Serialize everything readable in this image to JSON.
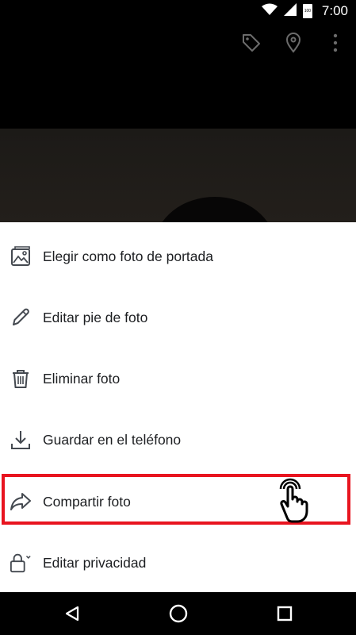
{
  "status_bar": {
    "time": "7:00",
    "battery_level": "100",
    "icons": [
      "wifi-icon",
      "signal-icon",
      "battery-icon"
    ]
  },
  "top_actions": {
    "icons": [
      "tag-icon",
      "location-pin-icon",
      "more-vertical-icon"
    ]
  },
  "menu": {
    "items": [
      {
        "label": "Elegir como foto de portada",
        "icon": "cover-photo-icon"
      },
      {
        "label": "Editar pie de foto",
        "icon": "pencil-icon"
      },
      {
        "label": "Eliminar foto",
        "icon": "trash-icon"
      },
      {
        "label": "Guardar en el teléfono",
        "icon": "download-icon"
      },
      {
        "label": "Compartir foto",
        "icon": "share-icon"
      },
      {
        "label": "Editar privacidad",
        "icon": "lock-icon"
      }
    ]
  },
  "annotation": {
    "highlighted_item": "Compartir foto",
    "highlight_color": "#e8141f",
    "pointer": "tap-hand-icon"
  },
  "nav_bar": {
    "buttons": [
      "back-icon",
      "home-icon",
      "recents-icon"
    ]
  }
}
